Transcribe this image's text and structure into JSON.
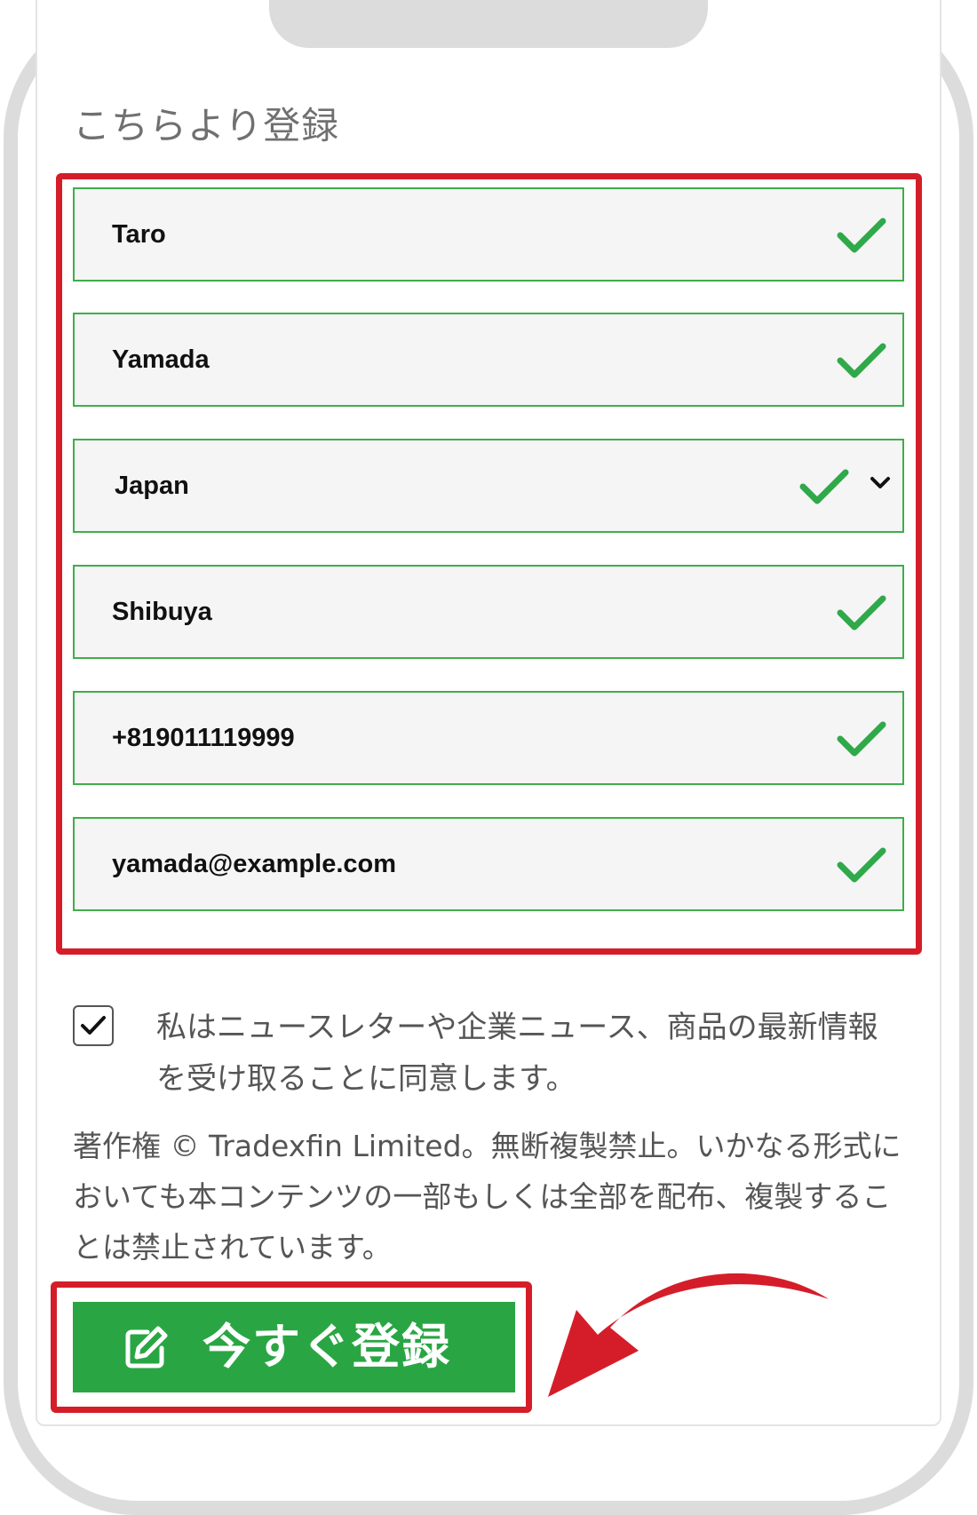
{
  "heading": "こちらより登録",
  "form": {
    "first_name": {
      "value": "Taro",
      "valid": true
    },
    "last_name": {
      "value": "Yamada",
      "valid": true
    },
    "country": {
      "value": "Japan",
      "valid": true,
      "type": "select"
    },
    "city": {
      "value": "Shibuya",
      "valid": true
    },
    "phone": {
      "value": "+819011119999",
      "valid": true
    },
    "email": {
      "value": "yamada@example.com",
      "valid": true
    }
  },
  "consent": {
    "checked": true,
    "text": "私はニュースレターや企業ニュース、商品の最新情報を受け取ることに同意します。"
  },
  "copyright": "著作権 © Tradexfin Limited。無断複製禁止。いかなる形式においても本コンテンツの一部もしくは全部を配布、複製することは禁止されています。",
  "submit": {
    "label": "今すぐ登録",
    "icon": "edit-icon"
  },
  "colors": {
    "accent_green": "#29a643",
    "valid_green": "#3fae49",
    "highlight_red": "#d51d2a",
    "text_gray": "#555555"
  }
}
